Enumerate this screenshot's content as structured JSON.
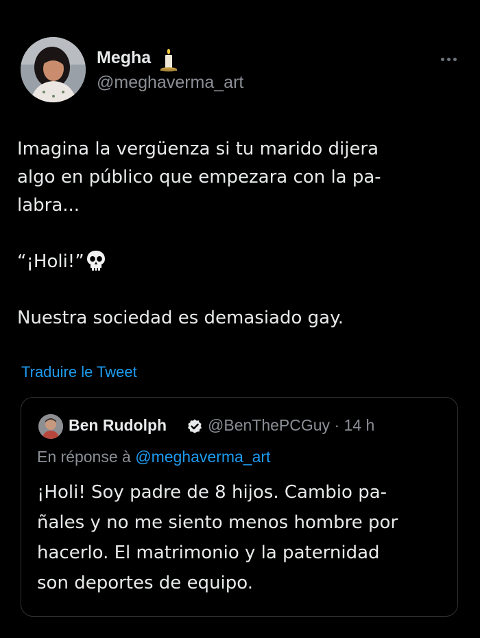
{
  "author": {
    "display_name": "Megha",
    "handle": "@meghaverma_art"
  },
  "tweet": {
    "lines": [
      "Imagina la vergüenza si tu marido dijera",
      "algo en público que empezara con la pa-",
      "labra...",
      "“¡Holi!”",
      "Nuestra sociedad es demasiado gay."
    ]
  },
  "translate_label": "Traduire le Tweet",
  "quoted": {
    "display_name": "Ben Rudolph",
    "handle": "@BenThePCGuy",
    "separator": "·",
    "time": "14 h",
    "reply_prefix": "En réponse à",
    "reply_to": "@meghaverma_art",
    "lines": [
      "¡Holi! Soy padre de 8 hijos. Cambio pa-",
      "ñales y no me siento menos hombre por",
      "hacerlo. El matrimonio y la paternidad",
      "son deportes de equipo."
    ]
  },
  "colors": {
    "background": "#000000",
    "text": "#e7e9ea",
    "secondary": "#8b8f95",
    "link": "#1d9bf0",
    "border": "#2f3336"
  },
  "icons": [
    "candle-icon",
    "more-icon",
    "skull-icon",
    "verified-icon"
  ]
}
